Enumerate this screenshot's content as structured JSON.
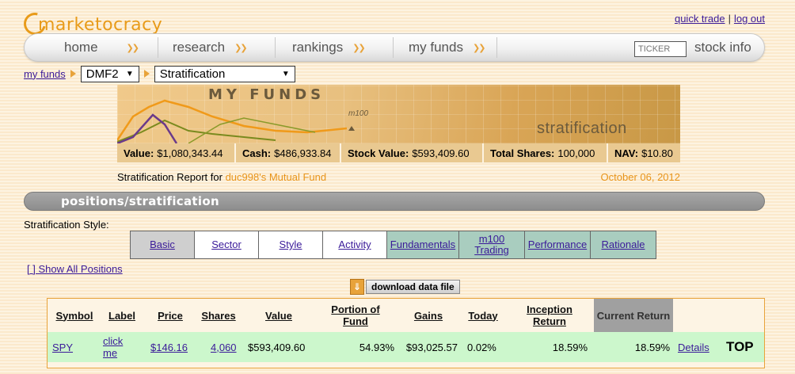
{
  "header": {
    "logo_text": "marketocracy",
    "quick_trade": "quick trade",
    "separator": "|",
    "log_out": "log out"
  },
  "nav": {
    "items": [
      {
        "label": "home",
        "chevron": "❯❯"
      },
      {
        "label": "research",
        "chevron": "❯❯"
      },
      {
        "label": "rankings",
        "chevron": "❯❯"
      },
      {
        "label": "my funds",
        "chevron": "❯❯"
      }
    ],
    "ticker_placeholder": "TICKER",
    "stock_info": "stock info"
  },
  "breadcrumb": {
    "my_funds": "my funds",
    "fund_select": "DMF2",
    "view_select": "Stratification"
  },
  "banner": {
    "title": "MY FUNDS",
    "m100": "m100",
    "subtitle": "stratification"
  },
  "stats": [
    {
      "label": "Value:",
      "value": "$1,080,343.44"
    },
    {
      "label": "Cash:",
      "value": "$486,933.84"
    },
    {
      "label": "Stock Value:",
      "value": "$593,409.60"
    },
    {
      "label": "Total Shares:",
      "value": "100,000"
    },
    {
      "label": "NAV:",
      "value": "$10.80"
    }
  ],
  "report": {
    "prefix": "Stratification Report for",
    "fund_name": "duc998's Mutual Fund",
    "date": "October 06, 2012"
  },
  "section": {
    "title": "positions/stratification"
  },
  "stratification": {
    "label": "Stratification Style:",
    "tabs": [
      {
        "label": "Basic",
        "state": "selected"
      },
      {
        "label": "Sector",
        "state": "white"
      },
      {
        "label": "Style",
        "state": "white"
      },
      {
        "label": "Activity",
        "state": "white"
      },
      {
        "label": "Fundamentals",
        "state": "green"
      },
      {
        "label": "m100 Trading",
        "state": "green"
      },
      {
        "label": "Performance",
        "state": "green"
      },
      {
        "label": "Rationale",
        "state": "green"
      }
    ]
  },
  "show_all": "[ ] Show All Positions",
  "download": {
    "icon": "download-icon",
    "label": "download data file"
  },
  "table": {
    "headers": [
      "Symbol",
      "Label",
      "Price",
      "Shares",
      "Value",
      "Portion of Fund",
      "Gains",
      "Today",
      "Inception Return",
      "Current Return"
    ],
    "rows": [
      {
        "symbol": "SPY",
        "label": "click me",
        "price": "$146.16",
        "shares": "4,060",
        "value": "$593,409.60",
        "portion": "54.93%",
        "gains": "$93,025.57",
        "today": "0.02%",
        "inception_return": "18.59%",
        "current_return": "18.59%",
        "details": "Details",
        "top": "TOP"
      }
    ]
  },
  "colors": {
    "accent_orange": "#e8a33a",
    "link": "#3a1a99",
    "row_green": "#ccf7cc",
    "tab_green": "#a9cdbf"
  }
}
